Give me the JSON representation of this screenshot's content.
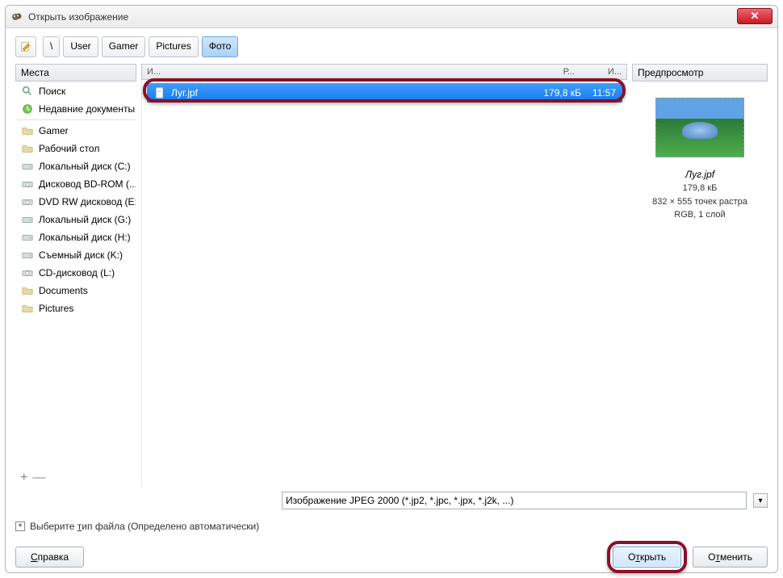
{
  "window": {
    "title": "Открыть изображение"
  },
  "breadcrumb": {
    "edit_icon": "pencil-icon",
    "items": [
      "\\",
      "User",
      "Gamer",
      "Pictures",
      "Фото"
    ],
    "active_index": 4
  },
  "places": {
    "header": "Места",
    "items": [
      {
        "icon": "search-icon",
        "label": "Поиск"
      },
      {
        "icon": "recent-icon",
        "label": "Недавние документы"
      },
      {
        "sep": true
      },
      {
        "icon": "folder-icon",
        "label": "Gamer"
      },
      {
        "icon": "folder-icon",
        "label": "Рабочий стол"
      },
      {
        "icon": "drive-icon",
        "label": "Локальный диск (C:)"
      },
      {
        "icon": "bdrom-icon",
        "label": "Дисковод BD-ROM (..."
      },
      {
        "icon": "dvd-icon",
        "label": "DVD RW дисковод (E:)"
      },
      {
        "icon": "drive-icon",
        "label": "Локальный диск (G:)"
      },
      {
        "icon": "drive-icon",
        "label": "Локальный диск (H:)"
      },
      {
        "icon": "drive-icon",
        "label": "Съемный диск (K:)"
      },
      {
        "icon": "cd-icon",
        "label": "CD-дисковод (L:)"
      },
      {
        "icon": "folder-icon",
        "label": "Documents"
      },
      {
        "icon": "folder-icon",
        "label": "Pictures"
      }
    ]
  },
  "file_header": {
    "name_col": "И...",
    "size_col": "Р...",
    "time_col": "И..."
  },
  "files": [
    {
      "icon": "file-icon",
      "name": "Луг.jpf",
      "size": "179,8 кБ",
      "time": "11:57",
      "selected": true
    }
  ],
  "preview": {
    "header": "Предпросмотр",
    "name": "Луг.jpf",
    "size": "179,8 кБ",
    "dims": "832 × 555 точек растра",
    "mode": "RGB, 1 слой"
  },
  "filter": {
    "text": "Изображение JPEG 2000 (*.jp2, *.jpc, *.jpx, *.j2k, ...)"
  },
  "filetype": {
    "label": "Выберите тип файла (Определено автоматически)"
  },
  "buttons": {
    "help": "Справка",
    "open": "Открыть",
    "cancel": "Отменить"
  },
  "add_remove": {
    "add": "+",
    "remove": "—"
  }
}
